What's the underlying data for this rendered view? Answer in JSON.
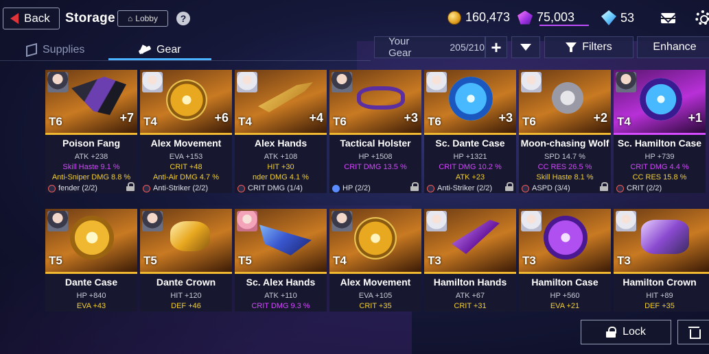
{
  "header": {
    "back_label": "Back",
    "title": "Storage",
    "lobby_label": "Lobby",
    "help_label": "?"
  },
  "currencies": {
    "gold": "160,473",
    "crystal": "75,003",
    "diamond": "53"
  },
  "tabs": [
    {
      "label": "Supplies",
      "icon": "cube-icon",
      "active": false
    },
    {
      "label": "Gear",
      "icon": "gear-tab-icon",
      "active": true
    }
  ],
  "controls": {
    "your_gear_label": "Your Gear",
    "gear_count": "205/210",
    "plus_label": "+",
    "filters_label": "Filters",
    "enhance_label": "Enhance"
  },
  "cards": [
    {
      "tier": "T6",
      "plus": "+7",
      "name": "Poison Fang",
      "s1": "ATK +238",
      "s2": "Skill Haste 9.1 %",
      "s3": "Anti-Sniper DMG 8.8 %",
      "set": "fender (2/2)",
      "locked": true
    },
    {
      "tier": "T4",
      "plus": "+6",
      "name": "Alex Movement",
      "s1": "EVA +153",
      "s2": "CRIT +48",
      "s3": "Anti-Air DMG 4.7 %",
      "set": "Anti-Striker (2/2)",
      "locked": false
    },
    {
      "tier": "T4",
      "plus": "+4",
      "name": "Alex Hands",
      "s1": "ATK +108",
      "s2": "HIT +30",
      "s3": "nder DMG 4.1 %",
      "set": "CRIT DMG (1/4)",
      "locked": false
    },
    {
      "tier": "T6",
      "plus": "+3",
      "name": "Tactical Holster",
      "s1": "HP +1508",
      "s2": "CRIT DMG 13.5 %",
      "s3": "",
      "set": "HP (2/2)",
      "locked": true
    },
    {
      "tier": "T6",
      "plus": "+3",
      "name": "Sc. Dante Case",
      "s1": "HP +1321",
      "s2": "CRIT DMG 10.2 %",
      "s3": "ATK +23",
      "set": "Anti-Striker (2/2)",
      "locked": true
    },
    {
      "tier": "T6",
      "plus": "+2",
      "name": "Moon-chasing Wolf",
      "s1": "SPD 14.7 %",
      "s2": "CC RES 26.5 %",
      "s3": "Skill Haste 8.1 %",
      "set": "ASPD (3/4)",
      "locked": true
    },
    {
      "tier": "T4",
      "plus": "+1",
      "name": "Sc. Hamilton Case",
      "s1": "HP +739",
      "s2": "CRIT DMG 4.4 %",
      "s3": "CC RES 15.8 %",
      "set": "CRIT (2/2)",
      "locked": false
    },
    {
      "tier": "T5",
      "plus": "",
      "name": "Dante Case",
      "s1": "HP +840",
      "s2": "EVA +43",
      "s3": "",
      "set": "",
      "locked": false
    },
    {
      "tier": "T5",
      "plus": "",
      "name": "Dante Crown",
      "s1": "HIT +120",
      "s2": "DEF +46",
      "s3": "",
      "set": "",
      "locked": false
    },
    {
      "tier": "T5",
      "plus": "",
      "name": "Sc. Alex Hands",
      "s1": "ATK +110",
      "s2": "CRIT DMG 9.3 %",
      "s3": "",
      "set": "",
      "locked": false
    },
    {
      "tier": "T4",
      "plus": "",
      "name": "Alex Movement",
      "s1": "EVA +105",
      "s2": "CRIT +35",
      "s3": "",
      "set": "",
      "locked": false
    },
    {
      "tier": "T3",
      "plus": "",
      "name": "Hamilton Hands",
      "s1": "ATK +67",
      "s2": "CRIT +31",
      "s3": "",
      "set": "",
      "locked": false
    },
    {
      "tier": "T3",
      "plus": "",
      "name": "Hamilton Case",
      "s1": "HP +560",
      "s2": "EVA +21",
      "s3": "",
      "set": "",
      "locked": false
    },
    {
      "tier": "T3",
      "plus": "",
      "name": "Hamilton Crown",
      "s1": "HIT +89",
      "s2": "DEF +35",
      "s3": "",
      "set": "",
      "locked": false
    }
  ],
  "bottom": {
    "lock_label": "Lock"
  }
}
